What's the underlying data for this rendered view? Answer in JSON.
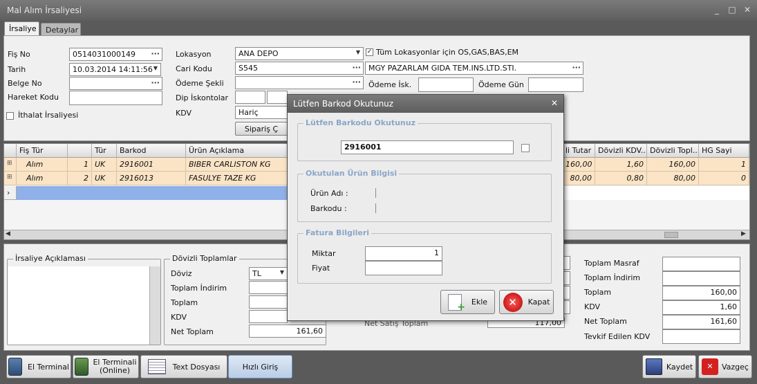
{
  "window": {
    "title": "Mal Alım İrsaliyesi",
    "minimize": "_",
    "maximize": "□",
    "close": "✕"
  },
  "tabs": [
    {
      "label": "İrsaliye"
    },
    {
      "label": "Detaylar"
    }
  ],
  "header": {
    "fis_no": {
      "label": "Fiş No",
      "value": "0514031000149"
    },
    "tarih": {
      "label": "Tarih",
      "value": "10.03.2014 14:11:56"
    },
    "belge_no": {
      "label": "Belge No",
      "value": ""
    },
    "hareket_kodu": {
      "label": "Hareket Kodu",
      "value": ""
    },
    "ithalat": {
      "label": "İthalat İrsaliyesi"
    },
    "lokasyon": {
      "label": "Lokasyon",
      "value": "ANA DEPO"
    },
    "tum_lokasyon": {
      "label": "Tüm Lokasyonlar için OS,GAS,BAS,EM"
    },
    "cari_kodu": {
      "label": "Cari Kodu",
      "value": "S545",
      "name": "MGY PAZARLAM GIDA TEM.INS.LTD.STI."
    },
    "odeme_sekli": {
      "label": "Ödeme Şekli",
      "value": ""
    },
    "odeme_isk": {
      "label": "Ödeme İsk."
    },
    "odeme_gun": {
      "label": "Ödeme Gün"
    },
    "dip_iskontolar": {
      "label": "Dip İskontolar"
    },
    "kdv": {
      "label": "KDV",
      "value": "Hariç"
    },
    "siparis_button": "Sipariş Ç"
  },
  "grid": {
    "columns": [
      "Fiş Tür",
      "",
      "Tür",
      "Barkod",
      "Ürün Açıklama",
      "li Tutar",
      "Dövizli KDV...",
      "Dövizli Topl...",
      "HG Sayi"
    ],
    "rows": [
      {
        "fis_tur": "Alım",
        "no": "1",
        "tur": "UK",
        "barkod": "2916001",
        "aciklama": "BIBER CARLISTON KG",
        "tutar": "160,00",
        "kdv": "1,60",
        "toplam": "160,00",
        "hg": "1"
      },
      {
        "fis_tur": "Alım",
        "no": "2",
        "tur": "UK",
        "barkod": "2916013",
        "aciklama": "FASULYE TAZE KG",
        "tutar": "80,00",
        "kdv": "0,80",
        "toplam": "80,00",
        "hg": "0"
      }
    ]
  },
  "aciklama": {
    "label": "İrsaliye Açıklaması"
  },
  "dovizli": {
    "title": "Dövizli Toplamlar",
    "doviz": {
      "label": "Döviz",
      "value": "TL"
    },
    "toplam_indirim": {
      "label": "Toplam İndirim"
    },
    "toplam": {
      "label": "Toplam"
    },
    "kdv": {
      "label": "KDV"
    },
    "net_toplam": {
      "label": "Net Toplam",
      "value": "161,60"
    }
  },
  "middle": {
    "net_satis_label": "Net Satış Toplam",
    "net_satis_value": "117,00"
  },
  "totals": {
    "toplam_masraf": {
      "label": "Toplam Masraf",
      "value": ""
    },
    "toplam_indirim": {
      "label": "Toplam İndirim",
      "value": ""
    },
    "toplam": {
      "label": "Toplam",
      "value": "160,00"
    },
    "kdv": {
      "label": "KDV",
      "value": "1,60"
    },
    "net_toplam": {
      "label": "Net Toplam",
      "value": "161,60"
    },
    "tevkif": {
      "label": "Tevkif Edilen KDV",
      "value": ""
    }
  },
  "footer": {
    "el_terminal": "El Terminal",
    "el_terminal_online_1": "El Terminali",
    "el_terminal_online_2": "(Online)",
    "text_dosyasi": "Text Dosyası",
    "hizli_giris": "Hızlı Giriş",
    "kaydet": "Kaydet",
    "vazgec": "Vazgeç"
  },
  "dialog": {
    "title": "Lütfen Barkod Okutunuz",
    "close": "✕",
    "group1": "Lütfen Barkodu Okutunuz",
    "barcode_value": "2916001",
    "group2": "Okutulan Ürün Bilgisi",
    "urun_adi": "Ürün Adı :",
    "barkodu": "Barkodu :",
    "group3": "Fatura Bilgileri",
    "miktar": {
      "label": "Miktar",
      "value": "1"
    },
    "fiyat": {
      "label": "Fiyat",
      "value": ""
    },
    "ekle": "Ekle",
    "kapat": "Kapat"
  }
}
